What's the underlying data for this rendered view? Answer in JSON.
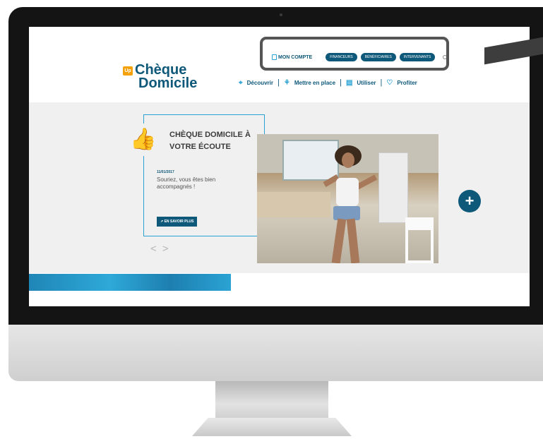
{
  "brand": {
    "badge": "Up",
    "line1": "Chèque",
    "line2": "Domicile",
    "color": "#0e5879",
    "accent": "#2aa3d4",
    "badge_color": "#f5a10a"
  },
  "top_nav": {
    "account_label": "MON COMPTE",
    "pills": [
      "FINANCEURS",
      "BÉNÉFICIAIRES",
      "INTERVENANTS"
    ],
    "search_icon": "search-icon",
    "lock_icon": "lock-icon"
  },
  "main_nav": [
    {
      "label": "Découvrir",
      "icon": "telescope-icon"
    },
    {
      "label": "Mettre en place",
      "icon": "handshake-icon"
    },
    {
      "label": "Utiliser",
      "icon": "document-icon"
    },
    {
      "label": "Profiter",
      "icon": "heart-icon"
    }
  ],
  "hero": {
    "title": "CHÈQUE DOMICILE À VOTRE ÉCOUTE",
    "date": "11/01/2017",
    "text": "Souriez, vous êtes bien accompagnés !",
    "button": "EN SAVOIR PLUS",
    "prev_arrow": "<",
    "next_arrow": ">",
    "plus_label": "+",
    "thumb_icon": "thumbs-up-icon"
  }
}
